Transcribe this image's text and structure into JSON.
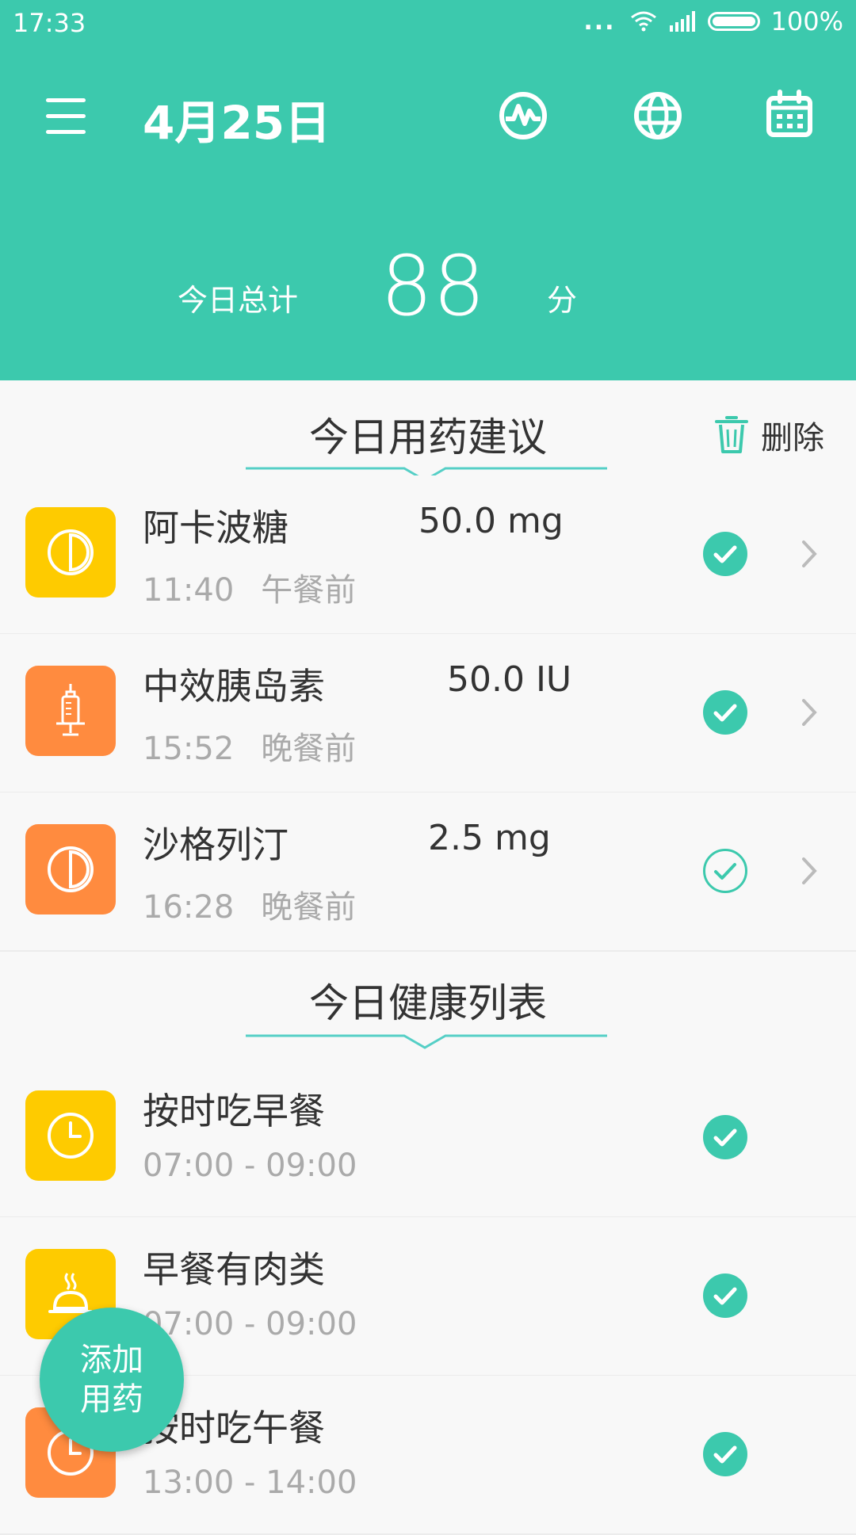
{
  "status_bar": {
    "time": "17:33",
    "dots": "...",
    "battery": "100%"
  },
  "header": {
    "date": "4月25日",
    "total_label": "今日总计",
    "total_value": "88",
    "total_unit": "分"
  },
  "icons": {
    "menu": "menu-icon",
    "pulse": "pulse-icon",
    "globe": "globe-icon",
    "calendar": "calendar-icon"
  },
  "medication": {
    "title": "今日用药建议",
    "delete_label": "删除",
    "items": [
      {
        "name": "阿卡波糖",
        "dose": "50.0 mg",
        "time": "11:40",
        "meal": "午餐前",
        "icon": "pill-icon",
        "color": "#fecb00",
        "done": true
      },
      {
        "name": "中效胰岛素",
        "dose": "50.0 IU",
        "time": "15:52",
        "meal": "晚餐前",
        "icon": "syringe-icon",
        "color": "#ff8b3f",
        "done": true
      },
      {
        "name": "沙格列汀",
        "dose": "2.5 mg",
        "time": "16:28",
        "meal": "晚餐前",
        "icon": "pill-icon",
        "color": "#ff8b3f",
        "done": false
      }
    ]
  },
  "health": {
    "title": "今日健康列表",
    "items": [
      {
        "name": "按时吃早餐",
        "time": "07:00 - 09:00",
        "icon": "clock-icon",
        "color": "#fecb00",
        "done": true
      },
      {
        "name": "早餐有肉类",
        "time": "07:00 - 09:00",
        "icon": "food-cover-icon",
        "color": "#fecb00",
        "done": true
      },
      {
        "name": "按时吃午餐",
        "time": "13:00 - 14:00",
        "icon": "clock-icon",
        "color": "#ff8b3f",
        "done": true
      }
    ]
  },
  "fab": {
    "line1": "添加",
    "line2": "用药"
  },
  "colors": {
    "primary": "#3cc9ad",
    "yellow": "#fecb00",
    "orange": "#ff8b3f"
  }
}
